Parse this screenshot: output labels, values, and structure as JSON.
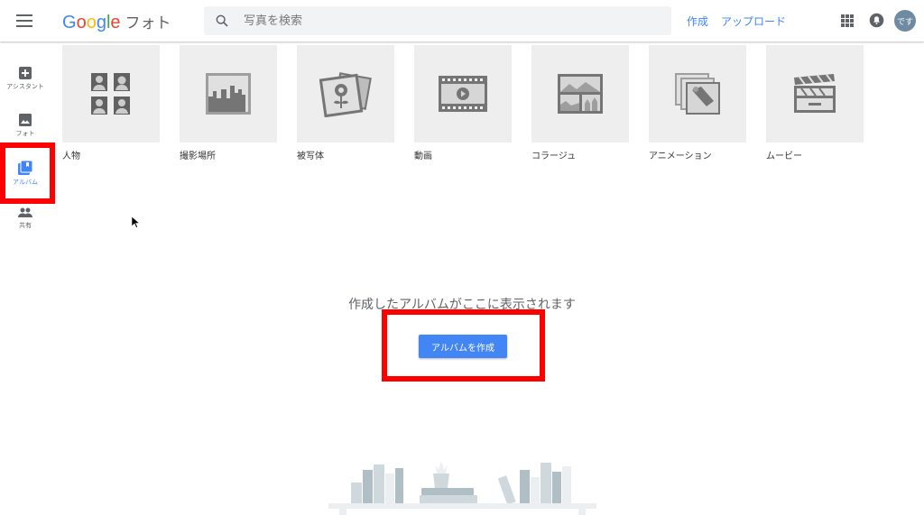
{
  "header": {
    "menu_icon": "hamburger-menu-icon",
    "logo_text": "Google",
    "product_name": "フォト",
    "search_placeholder": "写真を検索",
    "create_label": "作成",
    "upload_label": "アップロード",
    "avatar_text": "です"
  },
  "sidebar": {
    "items": [
      {
        "label": "アシスタント",
        "icon": "assistant-icon"
      },
      {
        "label": "フォト",
        "icon": "photo-icon"
      },
      {
        "label": "アルバム",
        "icon": "album-icon",
        "active": true
      },
      {
        "label": "共有",
        "icon": "people-icon"
      }
    ]
  },
  "categories": [
    {
      "label": "人物",
      "icon": "people-faces-icon"
    },
    {
      "label": "撮影場所",
      "icon": "city-icon"
    },
    {
      "label": "被写体",
      "icon": "flower-photo-icon"
    },
    {
      "label": "動画",
      "icon": "film-icon"
    },
    {
      "label": "コラージュ",
      "icon": "collage-icon"
    },
    {
      "label": "アニメーション",
      "icon": "stacked-photos-icon"
    },
    {
      "label": "ムービー",
      "icon": "clapperboard-icon"
    }
  ],
  "empty_state": {
    "message": "作成したアルバムがここに表示されます",
    "button_label": "アルバムを作成"
  },
  "colors": {
    "accent": "#4285f4",
    "highlight": "#ff0000",
    "tile_bg": "#eeeeee"
  }
}
